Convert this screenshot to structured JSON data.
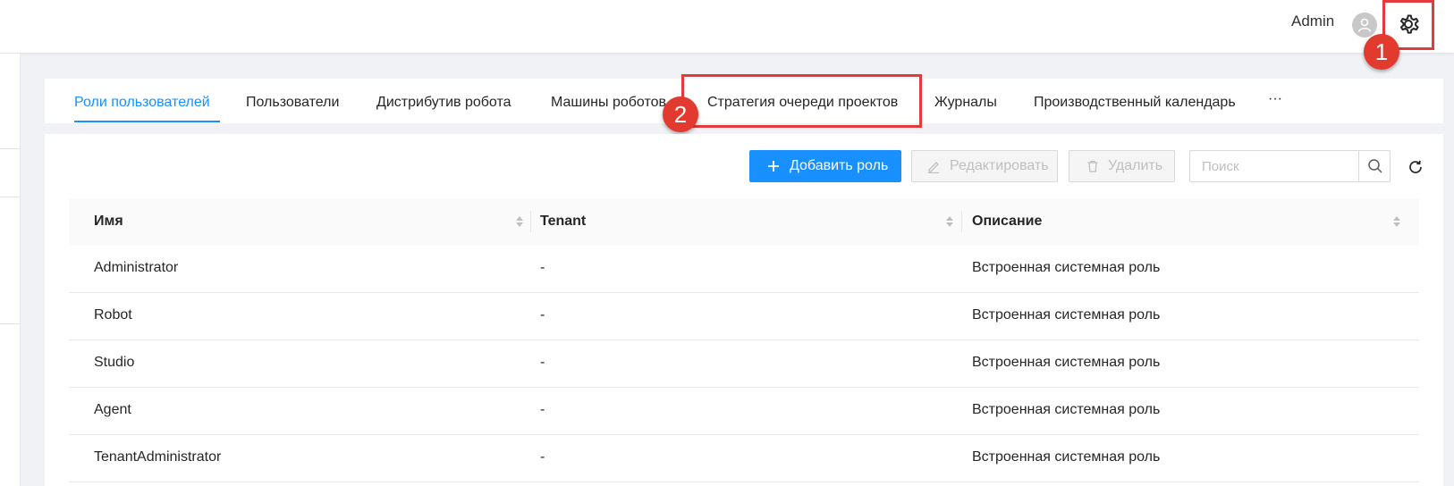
{
  "header": {
    "user_name": "Admin",
    "avatar_icon": "user-icon",
    "settings_icon": "gear-icon"
  },
  "annotations": [
    "1",
    "2"
  ],
  "tabs": [
    {
      "label": "Роли пользователей",
      "active": true
    },
    {
      "label": "Пользователи"
    },
    {
      "label": "Дистрибутив робота"
    },
    {
      "label": "Машины роботов"
    },
    {
      "label": "Стратегия очереди проектов"
    },
    {
      "label": "Журналы"
    },
    {
      "label": "Производственный календарь"
    },
    {
      "label": "···"
    }
  ],
  "toolbar": {
    "add_label": "Добавить роль",
    "edit_label": "Редактировать",
    "delete_label": "Удалить",
    "search_placeholder": "Поиск"
  },
  "table": {
    "columns": [
      "Имя",
      "Tenant",
      "Описание"
    ],
    "rows": [
      [
        "Administrator",
        "-",
        "Встроенная системная роль"
      ],
      [
        "Robot",
        "-",
        "Встроенная системная роль"
      ],
      [
        "Studio",
        "-",
        "Встроенная системная роль"
      ],
      [
        "Agent",
        "-",
        "Встроенная системная роль"
      ],
      [
        "TenantAdministrator",
        "-",
        "Встроенная системная роль"
      ]
    ]
  },
  "colors": {
    "accent": "#1890ff",
    "annotation": "#e33b3b"
  }
}
